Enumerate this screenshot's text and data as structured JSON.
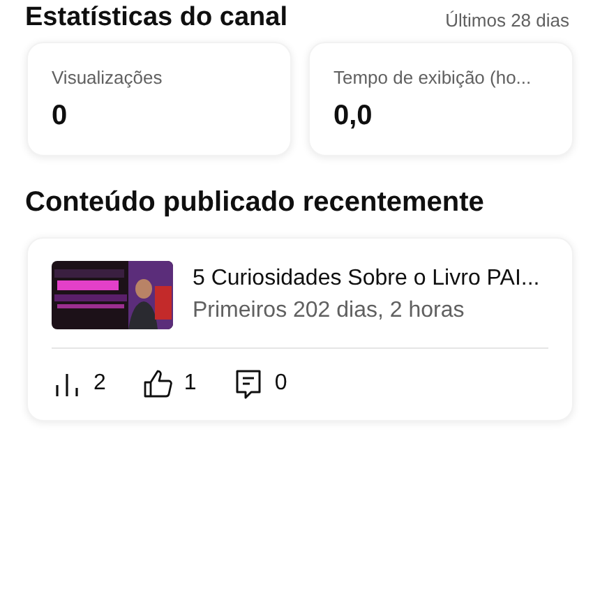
{
  "header": {
    "title": "Estatísticas do canal",
    "period": "Últimos 28 dias"
  },
  "stats": [
    {
      "label": "Visualizações",
      "value": "0"
    },
    {
      "label": "Tempo de exibição (ho...",
      "value": "0,0"
    }
  ],
  "recent": {
    "title": "Conteúdo publicado recentemente",
    "videos": [
      {
        "title": "5 Curiosidades Sobre o Livro PAI...",
        "subtitle": "Primeiros 202 dias, 2 horas",
        "metrics": [
          {
            "kind": "views",
            "value": "2"
          },
          {
            "kind": "likes",
            "value": "1"
          },
          {
            "kind": "comments",
            "value": "0"
          }
        ]
      }
    ]
  }
}
